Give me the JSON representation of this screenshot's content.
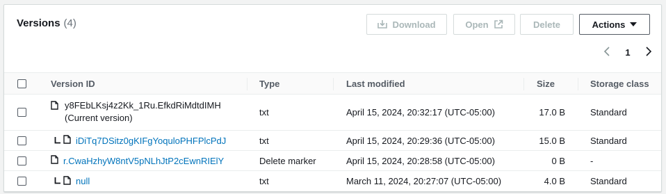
{
  "header": {
    "title": "Versions",
    "count": "(4)",
    "buttons": {
      "download": "Download",
      "open": "Open",
      "delete": "Delete",
      "actions": "Actions"
    },
    "pagination": {
      "page": "1"
    }
  },
  "table": {
    "columns": [
      "Version ID",
      "Type",
      "Last modified",
      "Size",
      "Storage class"
    ],
    "rows": [
      {
        "version_id": "y8FEbLKsj4z2Kk_1Ru.EfkdRiMdtdIMH",
        "note": "(Current version)",
        "type": "txt",
        "last_modified": "April 15, 2024, 20:32:17 (UTC-05:00)",
        "size": "17.0 B",
        "storage_class": "Standard"
      },
      {
        "version_id": "iDiTq7DSitz0gKIFgYoquloPHFPlcPdJ",
        "type": "txt",
        "last_modified": "April 15, 2024, 20:29:36 (UTC-05:00)",
        "size": "15.0 B",
        "storage_class": "Standard"
      },
      {
        "version_id": "r.CwaHzhyW8ntV5pNLhJtP2cEwnRIElY",
        "type": "Delete marker",
        "last_modified": "April 15, 2024, 20:28:58 (UTC-05:00)",
        "size": "0 B",
        "storage_class": "-"
      },
      {
        "version_id": "null",
        "type": "txt",
        "last_modified": "March 11, 2024, 20:27:07 (UTC-05:00)",
        "size": "4.0 B",
        "storage_class": "Standard"
      }
    ]
  },
  "colors": {
    "link": "#0073bb",
    "disabled_text": "#aab7b8",
    "border": "#d5dbdb",
    "text": "#16191f"
  },
  "icons": [
    "download-icon",
    "external-link-icon",
    "caret-down-icon",
    "chevron-left-icon",
    "chevron-right-icon",
    "file-icon",
    "child-version-icon"
  ]
}
